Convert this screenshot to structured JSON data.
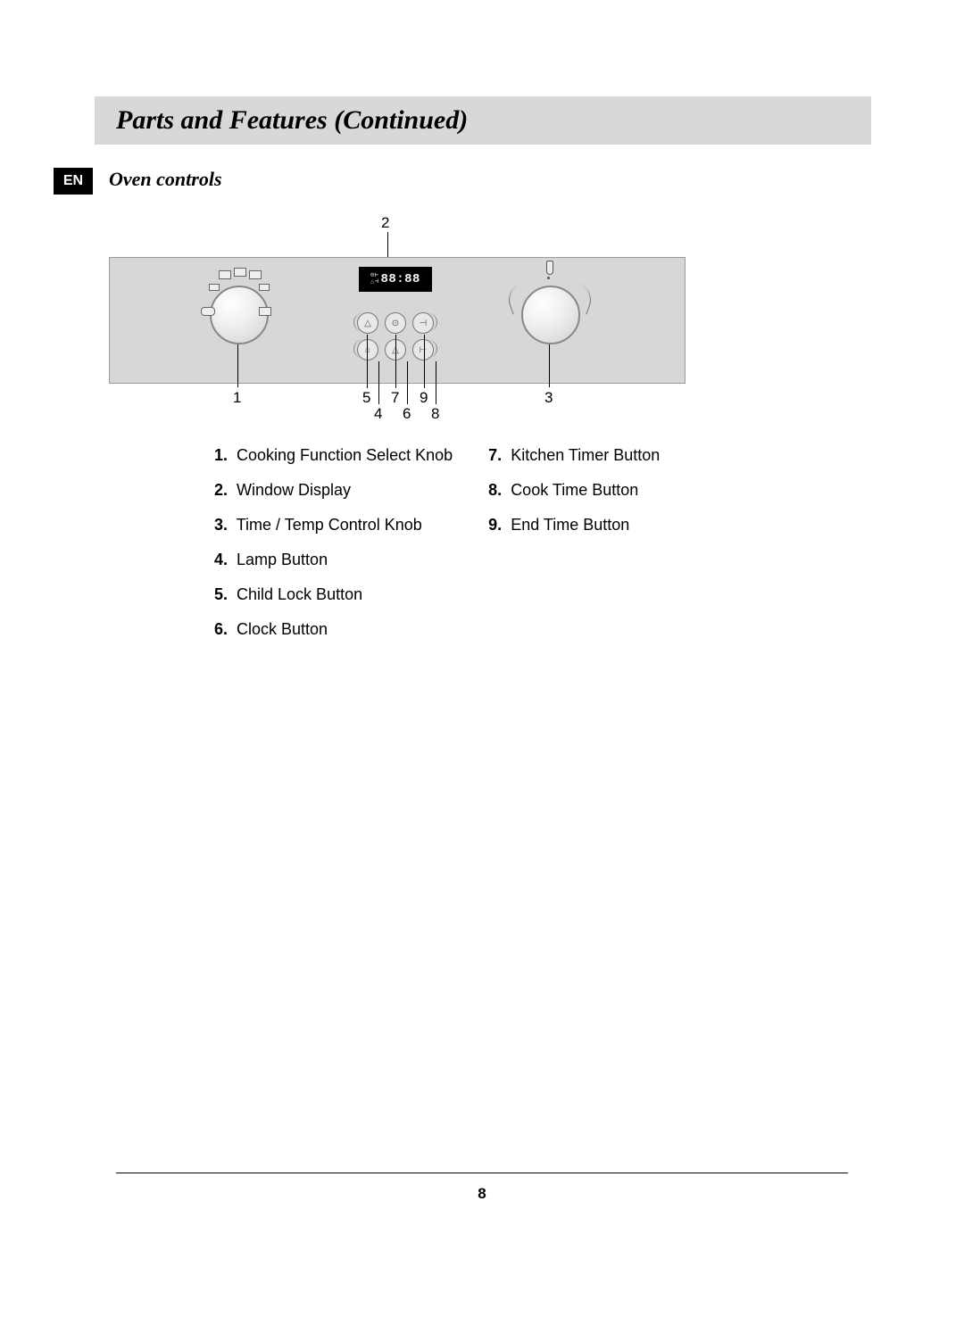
{
  "lang_badge": "EN",
  "title": "Parts and Features (Continued)",
  "subheading": "Oven controls",
  "display_value": "88:88",
  "callouts": {
    "1": "1",
    "2": "2",
    "3": "3",
    "4": "4",
    "5": "5",
    "6": "6",
    "7": "7",
    "8": "8",
    "9": "9"
  },
  "legend_left": [
    {
      "n": "1.",
      "text": "Cooking Function Select Knob"
    },
    {
      "n": "2.",
      "text": "Window Display"
    },
    {
      "n": "3.",
      "text": "Time / Temp Control Knob"
    },
    {
      "n": "4.",
      "text": "Lamp Button"
    },
    {
      "n": "5.",
      "text": "Child Lock Button"
    },
    {
      "n": "6.",
      "text": "Clock Button"
    }
  ],
  "legend_right": [
    {
      "n": "7.",
      "text": "Kitchen Timer Button"
    },
    {
      "n": "8.",
      "text": "Cook Time Button"
    },
    {
      "n": "9.",
      "text": "End Time Button"
    }
  ],
  "page_number": "8"
}
